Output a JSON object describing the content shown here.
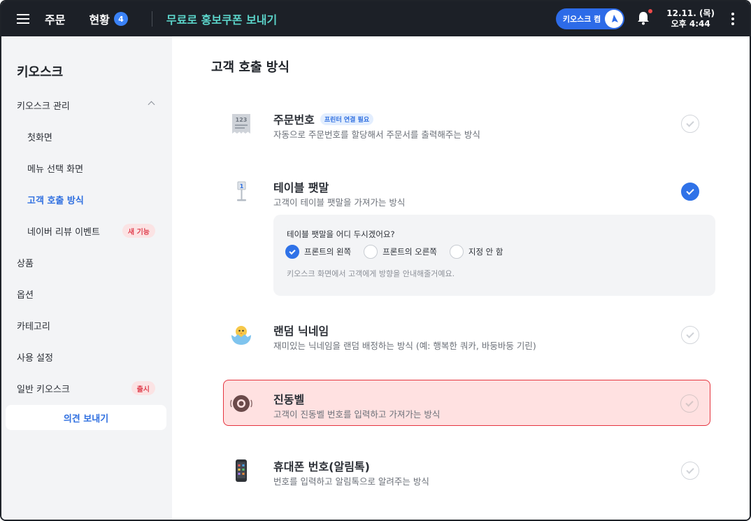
{
  "topbar": {
    "tabs": [
      {
        "label": "주문",
        "count": ""
      },
      {
        "label": "현황",
        "count": "4"
      }
    ],
    "promo_link": "무료로 홍보쿠폰 보내기",
    "kiosk_pill": "키오스크 켬",
    "clock_date": "12.11. (목)",
    "clock_time": "오후 4:44"
  },
  "sidebar": {
    "title": "키오스크",
    "group": "키오스크 관리",
    "sub_items": [
      {
        "label": "첫화면"
      },
      {
        "label": "메뉴 선택 화면"
      },
      {
        "label": "고객 호출 방식"
      },
      {
        "label": "네이버 리뷰 이벤트",
        "badge": "새 기능"
      }
    ],
    "items": [
      {
        "label": "상품"
      },
      {
        "label": "옵션"
      },
      {
        "label": "카테고리"
      },
      {
        "label": "사용 설정"
      },
      {
        "label": "일반 키오스크",
        "badge": "출시"
      }
    ],
    "feedback_button": "의견 보내기"
  },
  "main": {
    "title": "고객 호출 방식",
    "options": [
      {
        "label": "주문번호",
        "badge": "프린터 연결 필요",
        "desc": "자동으로 주문번호를 할당해서 주문서를 출력해주는 방식",
        "icon": "receipt-123-icon",
        "selected": false
      },
      {
        "label": "테이블 팻말",
        "badge": "",
        "desc": "고객이 테이블 팻말을 가져가는 방식",
        "icon": "table-sign-icon",
        "selected": true
      },
      {
        "label": "랜덤 닉네임",
        "badge": "",
        "desc": "재미있는 닉네임을 랜덤 배정하는 방식 (예: 행복한 쿼카, 바둥바둥 기린)",
        "icon": "chick-icon",
        "selected": false
      },
      {
        "label": "진동벨",
        "badge": "",
        "desc": "고객이 진동벨 번호를 입력하고 가져가는 방식",
        "icon": "vibration-bell-icon",
        "selected": false
      },
      {
        "label": "휴대폰 번호(알림톡)",
        "badge": "",
        "desc": "번호를 입력하고 알림톡으로 알려주는 방식",
        "icon": "phone-icon",
        "selected": false
      }
    ],
    "sub_panel": {
      "question": "테이블 팻말을 어디 두시겠어요?",
      "choices": [
        {
          "label": "프론트의 왼쪽",
          "selected": true
        },
        {
          "label": "프론트의 오른쪽",
          "selected": false
        },
        {
          "label": "지정 안 함",
          "selected": false
        }
      ],
      "hint": "키오스크 화면에서 고객에게 방향을 안내해줄거예요."
    }
  },
  "colors": {
    "accent": "#2f72e8",
    "topbar_bg": "#1c2027",
    "promo": "#5bd3c9",
    "highlight_bg": "#ffe1e1",
    "highlight_border": "#e5343f"
  }
}
